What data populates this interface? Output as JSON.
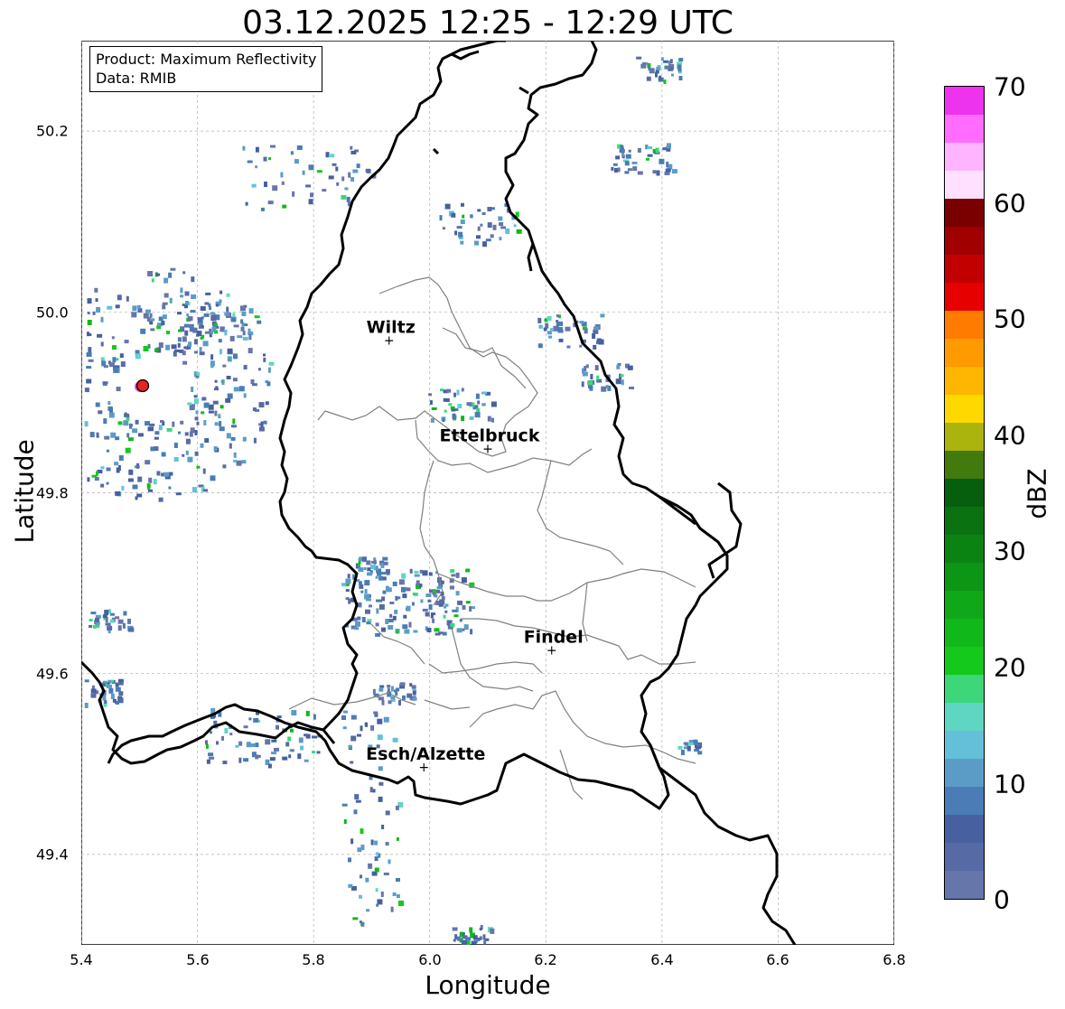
{
  "title": "03.12.2025 12:25 - 12:29 UTC",
  "legend": {
    "product": "Product: Maximum Reflectivity",
    "data": "Data: RMIB"
  },
  "axes": {
    "xlabel": "Longitude",
    "ylabel": "Latitude",
    "xticks": [
      "5.4",
      "5.6",
      "5.8",
      "6.0",
      "6.2",
      "6.4",
      "6.6",
      "6.8"
    ],
    "yticks": [
      "50.2",
      "50.0",
      "49.8",
      "49.6",
      "49.4"
    ],
    "xlim": [
      5.4,
      6.8
    ],
    "ylim": [
      49.3,
      50.3
    ]
  },
  "colorbar": {
    "label": "dBZ",
    "ticks": [
      "0",
      "10",
      "20",
      "30",
      "40",
      "50",
      "60",
      "70"
    ],
    "range": [
      0,
      70
    ],
    "colors": [
      "#6675aa",
      "#566aa5",
      "#4660a0",
      "#4a7cb5",
      "#5b9cc6",
      "#64bfd9",
      "#5fd6c2",
      "#3dd679",
      "#14c81c",
      "#11b819",
      "#0fa819",
      "#0d9516",
      "#0b8313",
      "#0a7211",
      "#065f0c",
      "#437a0d",
      "#aab40c",
      "#ffd800",
      "#ffb600",
      "#ff9a00",
      "#ff7c00",
      "#e60000",
      "#c30000",
      "#a00000",
      "#7a0000",
      "#ffe1ff",
      "#ffb4ff",
      "#ff6cff",
      "#ee33ee"
    ]
  },
  "places": [
    {
      "name": "Wiltz",
      "lon": 5.93,
      "lat": 49.969
    },
    {
      "name": "Ettelbruck",
      "lon": 6.1,
      "lat": 49.849
    },
    {
      "name": "Findel",
      "lon": 6.21,
      "lat": 49.626
    },
    {
      "name": "Esch/Alzette",
      "lon": 5.99,
      "lat": 49.497
    }
  ],
  "radar_site": {
    "lon": 5.505,
    "lat": 49.914
  }
}
